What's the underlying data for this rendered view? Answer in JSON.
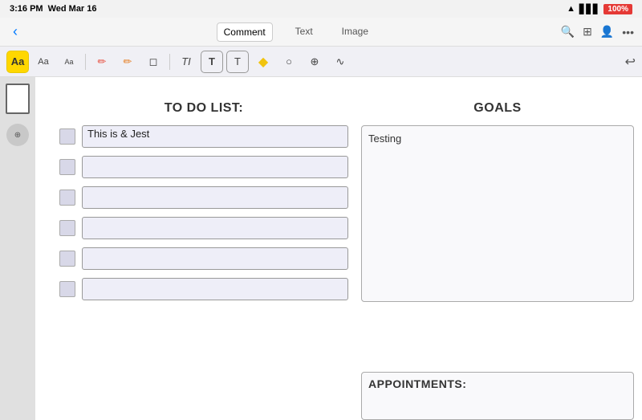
{
  "statusBar": {
    "time": "3:16 PM",
    "date": "Wed Mar 16",
    "battery": "100%",
    "batteryLabel": "100%"
  },
  "navBar": {
    "backLabel": "‹",
    "tabs": [
      {
        "id": "comment",
        "label": "Comment",
        "active": true
      },
      {
        "id": "text",
        "label": "Text",
        "active": false
      },
      {
        "id": "image",
        "label": "Image",
        "active": false
      }
    ],
    "icons": {
      "search": "🔍",
      "grid": "⊞",
      "more": "···"
    }
  },
  "toolbar": {
    "tools": [
      {
        "id": "font-bold",
        "label": "Aa",
        "style": "bold",
        "active": true
      },
      {
        "id": "font-medium",
        "label": "Aa",
        "style": "normal",
        "active": false
      },
      {
        "id": "font-small",
        "label": "Aa",
        "style": "small",
        "active": false
      },
      {
        "id": "pen-red",
        "label": "✏",
        "color": "#e74c3c",
        "active": false
      },
      {
        "id": "pen-orange",
        "label": "✏",
        "color": "#e67e22",
        "active": false
      },
      {
        "id": "eraser",
        "label": "◻",
        "active": false
      },
      {
        "id": "text-t1",
        "label": "TI",
        "active": false
      },
      {
        "id": "text-box1",
        "label": "T",
        "active": false
      },
      {
        "id": "text-box2",
        "label": "T",
        "active": false
      },
      {
        "id": "highlight",
        "label": "◆",
        "color": "#f1c40f",
        "active": false
      },
      {
        "id": "shape",
        "label": "○",
        "active": false
      },
      {
        "id": "stamp",
        "label": "⊕",
        "active": false
      },
      {
        "id": "draw",
        "label": "∿",
        "active": false
      }
    ],
    "undoLabel": "↩"
  },
  "page": {
    "todoSection": {
      "title": "TO DO LIST:",
      "items": [
        {
          "id": 1,
          "text": "This is & Jest",
          "checked": false
        },
        {
          "id": 2,
          "text": "",
          "checked": false
        },
        {
          "id": 3,
          "text": "",
          "checked": false
        },
        {
          "id": 4,
          "text": "",
          "checked": false
        },
        {
          "id": 5,
          "text": "",
          "checked": false
        },
        {
          "id": 6,
          "text": "",
          "checked": false
        }
      ]
    },
    "goalsSection": {
      "title": "GOALS",
      "content": "Testing"
    },
    "appointmentsSection": {
      "title": "APPOINTMENTS:"
    }
  }
}
